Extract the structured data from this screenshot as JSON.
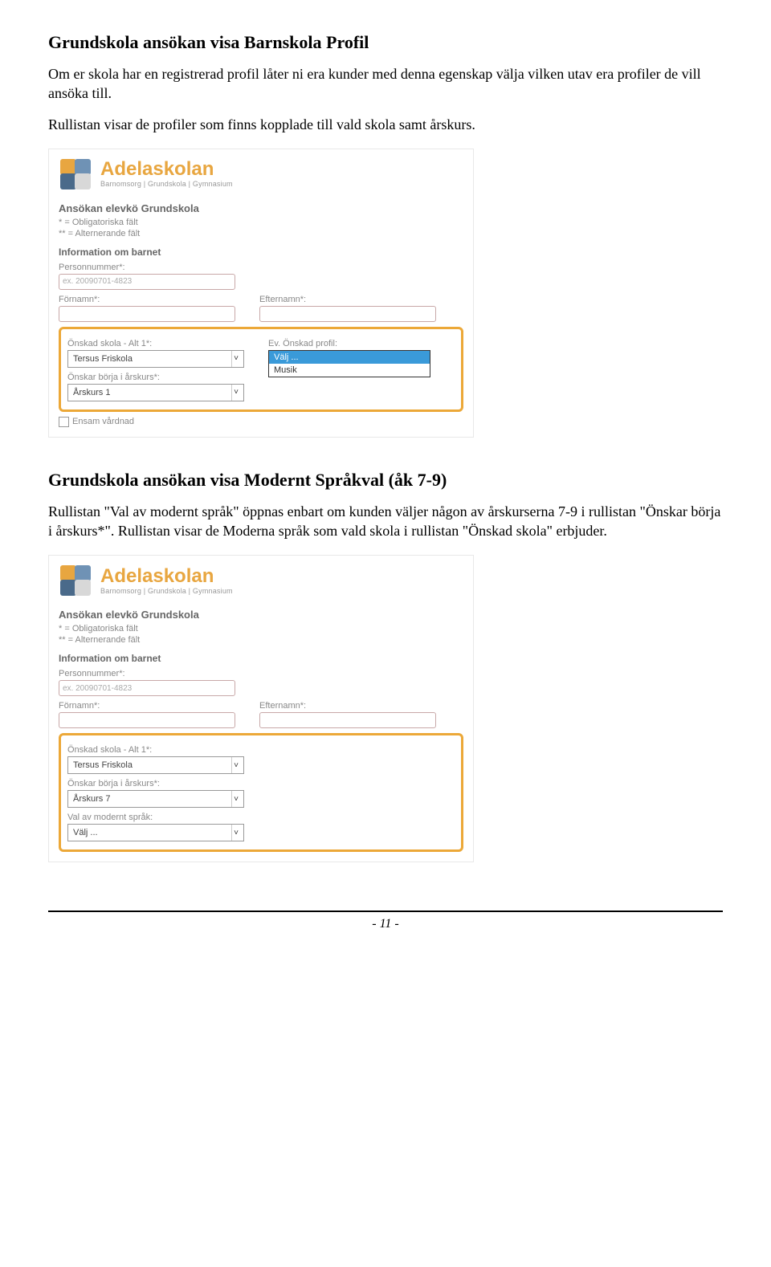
{
  "section1": {
    "title": "Grundskola ansökan visa Barnskola Profil",
    "p1": "Om er skola har en registrerad profil låter ni era kunder med denna egenskap välja vilken utav era profiler de vill ansöka till.",
    "p2": "Rullistan visar de profiler som finns kopplade till vald skola samt årskurs."
  },
  "logo": {
    "name": "Adelaskolan",
    "sub": "Barnomsorg | Grundskola | Gymnasium"
  },
  "shot1": {
    "heading": "Ansökan elevkö Grundskola",
    "note1": "* = Obligatoriska fält",
    "note2": "** = Alternerande fält",
    "sub1": "Information om barnet",
    "pn_label": "Personnummer*:",
    "pn_placeholder": "ex. 20090701-4823",
    "fn_label": "Förnamn*:",
    "en_label": "Efternamn*:",
    "skola_label": "Önskad skola - Alt 1*:",
    "skola_val": "Tersus Friskola",
    "profil_label": "Ev. Önskad profil:",
    "profil_opt1": "Välj ...",
    "profil_opt2": "Musik",
    "arskurs_label": "Önskar börja i årskurs*:",
    "arskurs_val": "Årskurs 1",
    "ensam_label": "Ensam vårdnad"
  },
  "section2": {
    "title": "Grundskola ansökan visa Modernt Språkval (åk 7-9)",
    "p1": "Rullistan \"Val av modernt språk\" öppnas enbart om kunden väljer någon av årskurserna 7-9 i rullistan \"Önskar börja i årskurs*\". Rullistan visar de Moderna språk som vald skola i rullistan \"Önskad skola\" erbjuder."
  },
  "shot2": {
    "heading": "Ansökan elevkö Grundskola",
    "note1": "* = Obligatoriska fält",
    "note2": "** = Alternerande fält",
    "sub1": "Information om barnet",
    "pn_label": "Personnummer*:",
    "pn_placeholder": "ex. 20090701-4823",
    "fn_label": "Förnamn*:",
    "en_label": "Efternamn*:",
    "skola_label": "Önskad skola - Alt 1*:",
    "skola_val": "Tersus Friskola",
    "arskurs_label": "Önskar börja i årskurs*:",
    "arskurs_val": "Årskurs 7",
    "sprak_label": "Val av modernt språk:",
    "sprak_val": "Välj ..."
  },
  "page": "- 11 -"
}
